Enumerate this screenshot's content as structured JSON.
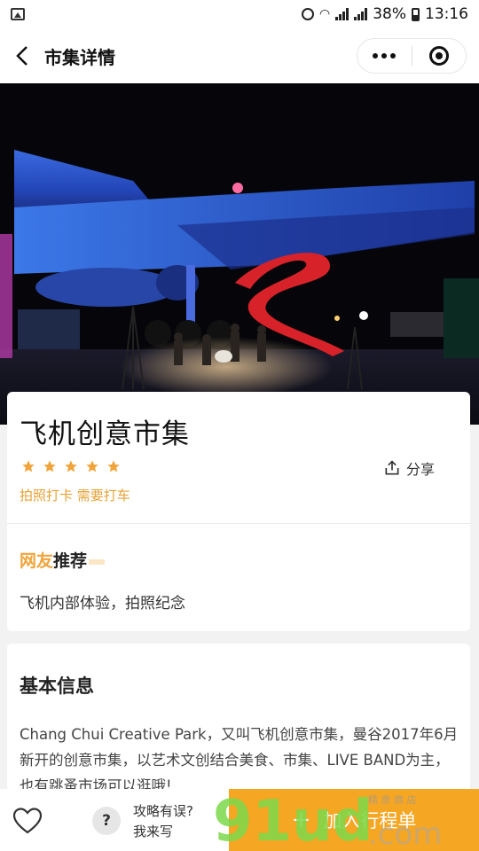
{
  "status_bar": {
    "battery": "38%",
    "time": "13:16"
  },
  "nav": {
    "title": "市集详情"
  },
  "place": {
    "title": "飞机创意市集",
    "rating": 5,
    "tags": "拍照打卡 需要打车",
    "share_label": "分享"
  },
  "recommend": {
    "title_highlight": "网友",
    "title_rest": "推荐",
    "text": "飞机内部体验，拍照纪念"
  },
  "basic_info": {
    "title": "基本信息",
    "text": "Chang Chui Creative Park，又叫飞机创意市集，曼谷2017年6月新开的创意市集，以艺术文创结合美食、市集、LIVE BAND为主，也有跳蚤市场可以逛哦!"
  },
  "bottom": {
    "help_line1": "攻略有误?",
    "help_line2": "我来写",
    "help_icon": "?",
    "add_label": "加入行程单",
    "add_icon": "+"
  },
  "watermark": {
    "text": "91ud",
    "suffix": ".com",
    "small": "精 彦 商 店"
  },
  "colors": {
    "accent": "#f5a623",
    "tag": "#e6a234",
    "star": "#f0a43a"
  }
}
